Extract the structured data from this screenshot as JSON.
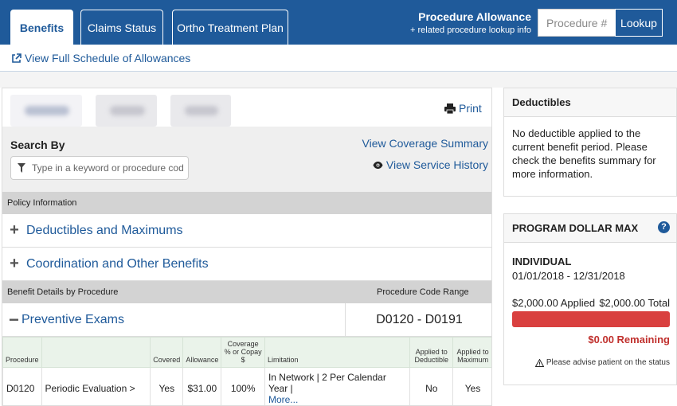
{
  "nav": {
    "tabs": [
      {
        "label": "Benefits"
      },
      {
        "label": "Claims Status"
      },
      {
        "label": "Ortho Treatment Plan"
      }
    ],
    "procedure_allowance": {
      "title": "Procedure Allowance",
      "subtitle": "+ related procedure lookup info",
      "input_placeholder": "Procedure #",
      "lookup_label": "Lookup"
    }
  },
  "schedule": {
    "link_label": "View Full Schedule of Allowances"
  },
  "main": {
    "print_label": "Print",
    "search": {
      "label": "Search By",
      "placeholder": "Type in a keyword or procedure code",
      "coverage_summary": "View Coverage Summary",
      "service_history": "View Service History"
    },
    "policy_info_label": "Policy Information",
    "accordions": [
      {
        "symbol": "+",
        "label": "Deductibles and Maximums"
      },
      {
        "symbol": "+",
        "label": "Coordination and Other Benefits"
      }
    ],
    "benefit_details_label": "Benefit Details by Procedure",
    "procedure_code_range_label": "Procedure Code Range",
    "preventive": {
      "symbol": "−",
      "label": "Preventive Exams",
      "range": "D0120 - D0191"
    },
    "table": {
      "headers": [
        "Procedure",
        "",
        "Covered",
        "Allowance",
        "Coverage % or Copay $",
        "Limitation",
        "Applied to Deductible",
        "Applied to Maximum"
      ],
      "rows": [
        {
          "code": "D0120",
          "description": "Periodic Evaluation >",
          "covered": "Yes",
          "allowance": "$31.00",
          "coverage": "100%",
          "limitation": "In Network | 2 Per Calendar Year |",
          "more": "More...",
          "applied_deductible": "No",
          "applied_maximum": "Yes"
        }
      ]
    }
  },
  "deductibles": {
    "title": "Deductibles",
    "body": "No deductible applied to the current benefit period. Please check the benefits summary for more information."
  },
  "program_dollar_max": {
    "title": "PROGRAM DOLLAR MAX",
    "help_icon": "?",
    "individual_label": "INDIVIDUAL",
    "dates": "01/01/2018 - 12/31/2018",
    "applied": "$2,000.00 Applied",
    "total": "$2,000.00 Total",
    "applied_fraction": 1.0,
    "remaining": "$0.00 Remaining",
    "advise": "Please advise patient on the status",
    "bar_color": "#d9403f"
  },
  "colors": {
    "brand": "#1f5a9a",
    "alert": "#c0302d"
  }
}
